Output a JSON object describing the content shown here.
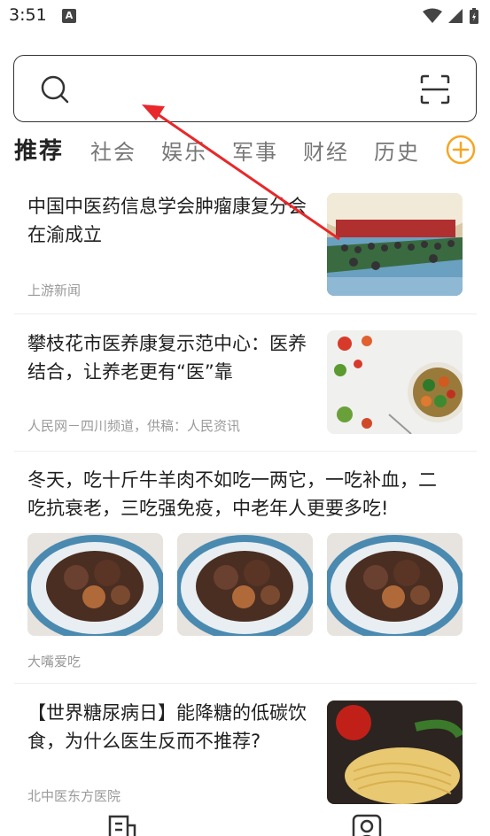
{
  "status": {
    "time": "3:51",
    "notif_glyph": "A"
  },
  "search": {
    "placeholder": ""
  },
  "tabs": [
    "推荐",
    "社会",
    "娱乐",
    "军事",
    "财经",
    "历史"
  ],
  "articles": [
    {
      "title_line1": "中国中医药信息学会肿瘤康复分会",
      "title_line2": "在渝成立",
      "source": "上游新闻"
    },
    {
      "title_line1": "攀枝花市医养康复示范中心：医养",
      "title_line2": "结合，让养老更有“医”靠",
      "source": "人民网－四川频道，供稿：人民资讯"
    },
    {
      "title_line1": "冬天，吃十斤牛羊肉不如吃一两它，一吃补血，二",
      "title_line2": "吃抗衰老，三吃强免疫，中老年人更要多吃!",
      "source": "大嘴爱吃"
    },
    {
      "title_line1": "【世界糖尿病日】能降糖的低碳饮",
      "title_line2": "食，为什么医生反而不推荐?",
      "source": "北中医东方医院"
    }
  ],
  "colors": {
    "accent": "#f5a623",
    "annotation_red": "#e8282a"
  },
  "icons": {
    "search": "search-icon",
    "scan": "scan-icon",
    "add_channel": "plus-circle-icon",
    "nav_news": "news-icon",
    "nav_profile": "profile-icon"
  }
}
